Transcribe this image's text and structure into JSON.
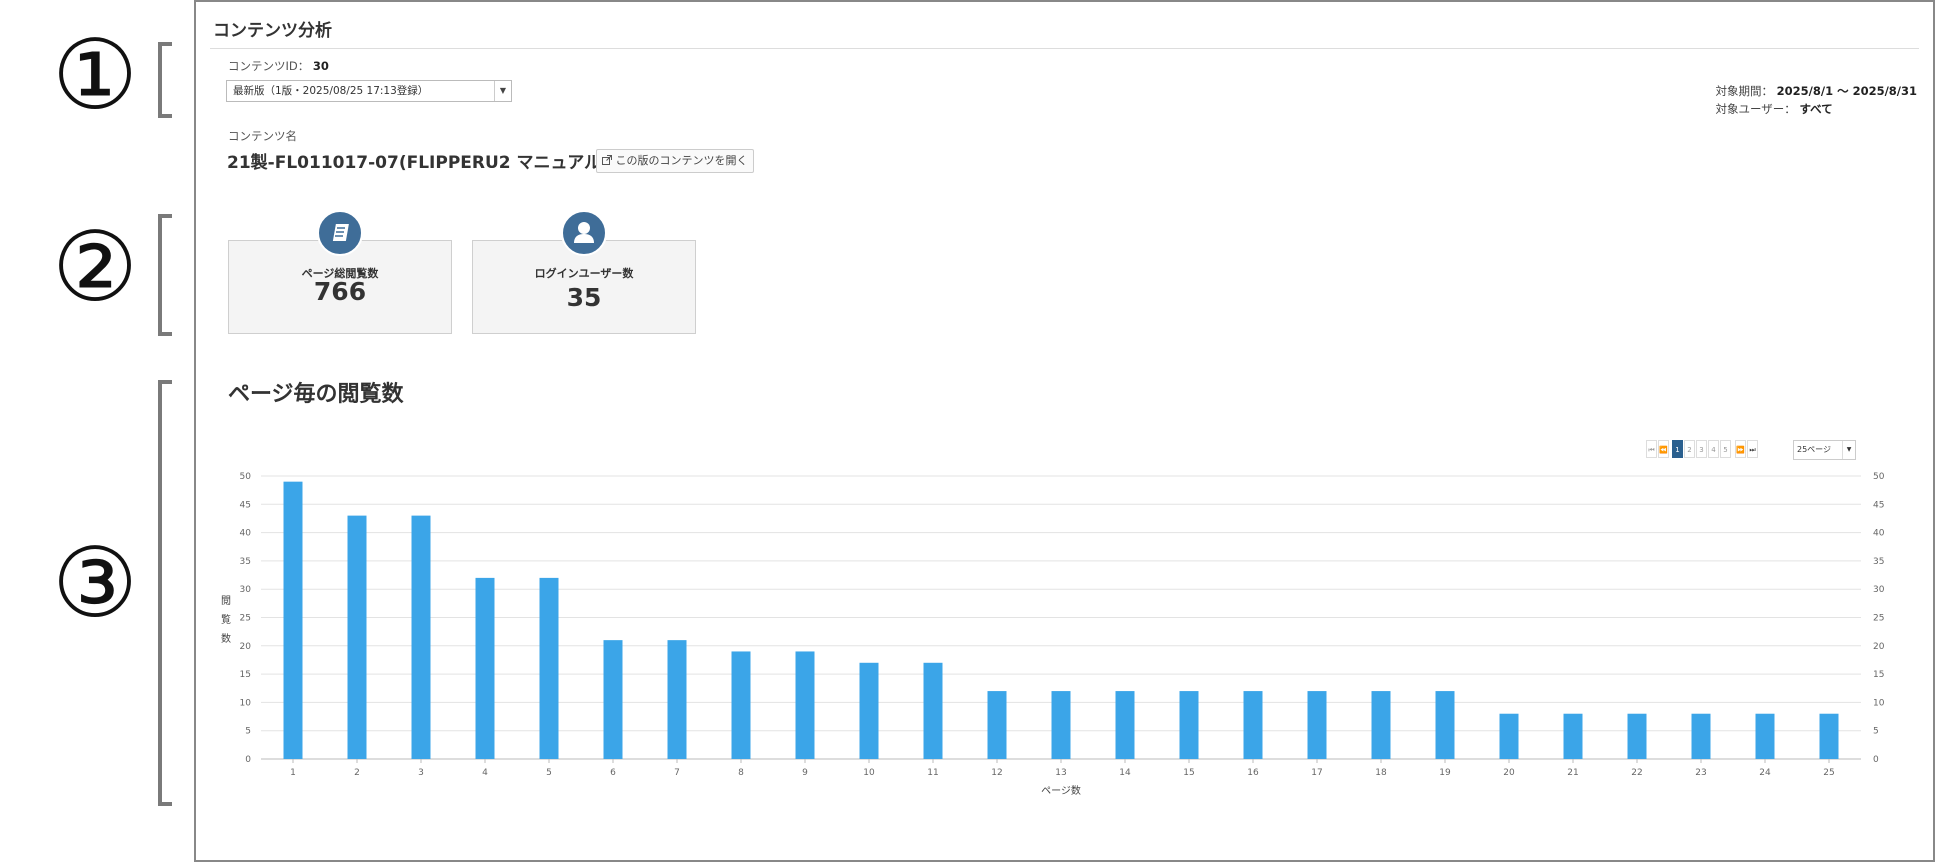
{
  "annotations": {
    "m1": "①",
    "m2": "②",
    "m3": "③"
  },
  "panel": {
    "title": "コンテンツ分析"
  },
  "content": {
    "id_label": "コンテンツID：",
    "id_value": "30",
    "version_select": "最新版（1版・2025/08/25 17:13登録）",
    "name_label": "コンテンツ名",
    "name": "21製-FL011017-07(FLIPPERU2 マニュアル)",
    "open_button": "この版のコンテンツを開く"
  },
  "meta": {
    "period_label": "対象期間：",
    "period_value": "2025/8/1 ～ 2025/8/31",
    "user_label": "対象ユーザー：",
    "user_value": "すべて"
  },
  "cards": [
    {
      "label": "ページ総閲覧数",
      "value": "766",
      "icon": "book-icon"
    },
    {
      "label": "ログインユーザー数",
      "value": "35",
      "icon": "user-icon"
    }
  ],
  "section_title": "ページ毎の閲覧数",
  "pager": {
    "first": "⏮",
    "prev": "⏪",
    "pages": [
      "1",
      "2",
      "3",
      "4",
      "5"
    ],
    "active_page": "1",
    "next": "⏩",
    "last": "⏭",
    "per_page": "25ページ"
  },
  "colors": {
    "bar": "#3ba5e8",
    "icon_bg": "#3f6d98",
    "pager_active": "#2a5f8e"
  },
  "chart_data": {
    "type": "bar",
    "xlabel": "ページ数",
    "ylabel": "閲覧数",
    "ylim": [
      0,
      50
    ],
    "yticks": [
      0,
      5,
      10,
      15,
      20,
      25,
      30,
      35,
      40,
      45,
      50
    ],
    "grid": true,
    "categories": [
      "1",
      "2",
      "3",
      "4",
      "5",
      "6",
      "7",
      "8",
      "9",
      "10",
      "11",
      "12",
      "13",
      "14",
      "15",
      "16",
      "17",
      "18",
      "19",
      "20",
      "21",
      "22",
      "23",
      "24",
      "25"
    ],
    "values": [
      49,
      43,
      43,
      32,
      32,
      21,
      21,
      19,
      19,
      17,
      17,
      12,
      12,
      12,
      12,
      12,
      12,
      12,
      12,
      8,
      8,
      8,
      8,
      8,
      8
    ]
  }
}
